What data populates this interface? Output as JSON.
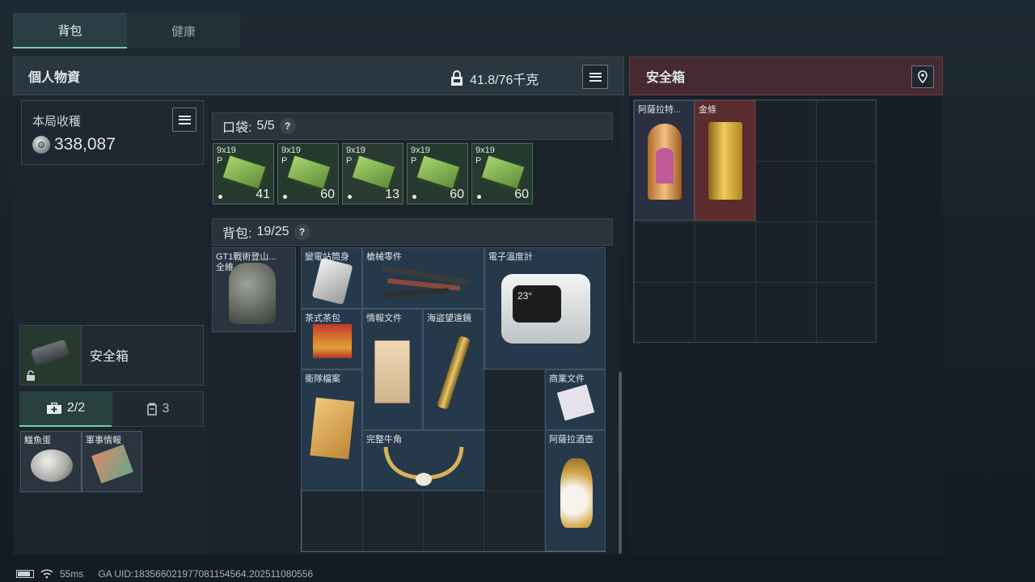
{
  "tabs": [
    {
      "label": "背包"
    },
    {
      "label": "健康"
    }
  ],
  "personal": {
    "title": "個人物資",
    "weight": "41.8/76千克"
  },
  "safebox_panel": {
    "title": "安全箱"
  },
  "harvest": {
    "title": "本局收穫",
    "value": "338,087"
  },
  "safe_slot": {
    "label": "安全箱"
  },
  "subtabs": [
    {
      "label": "2/2"
    },
    {
      "label": "3"
    }
  ],
  "mini_items": [
    {
      "label": "鱷魚蛋"
    },
    {
      "label": "軍事情報"
    }
  ],
  "pocket": {
    "label": "口袋:",
    "count": "5/5",
    "help": "?"
  },
  "ammo": [
    {
      "name": "9x19 P",
      "count": "41"
    },
    {
      "name": "9x19 P",
      "count": "60"
    },
    {
      "name": "9x19 P",
      "count": "13"
    },
    {
      "name": "9x19 P",
      "count": "60"
    },
    {
      "name": "9x19 P",
      "count": "60"
    }
  ],
  "backpack": {
    "label": "背包:",
    "count": "19/25",
    "help": "?",
    "bag_name": "GT1戰術登山...",
    "bag_sub": "全維"
  },
  "backpack_items": [
    {
      "label": "變電站筒身"
    },
    {
      "label": "槍械零件"
    },
    {
      "label": "電子溫度計"
    },
    {
      "label": "茶式茶包"
    },
    {
      "label": "情報文件"
    },
    {
      "label": "海盜望遠鏡"
    },
    {
      "label": "衛隊檔案"
    },
    {
      "label": "商業文件"
    },
    {
      "label": "完整牛角"
    },
    {
      "label": "阿薩拉酒壺"
    }
  ],
  "thermo_display": "23°",
  "safe_items": [
    {
      "label": "阿薩拉特..."
    },
    {
      "label": "金條"
    }
  ],
  "status": {
    "ping": "55ms",
    "uid": "GA UID:18356602197708115456​4.202511080556"
  },
  "colors": {
    "accent": "#6fd0a6",
    "safe_header": "#472a31",
    "grid_border": "#556a7a"
  }
}
